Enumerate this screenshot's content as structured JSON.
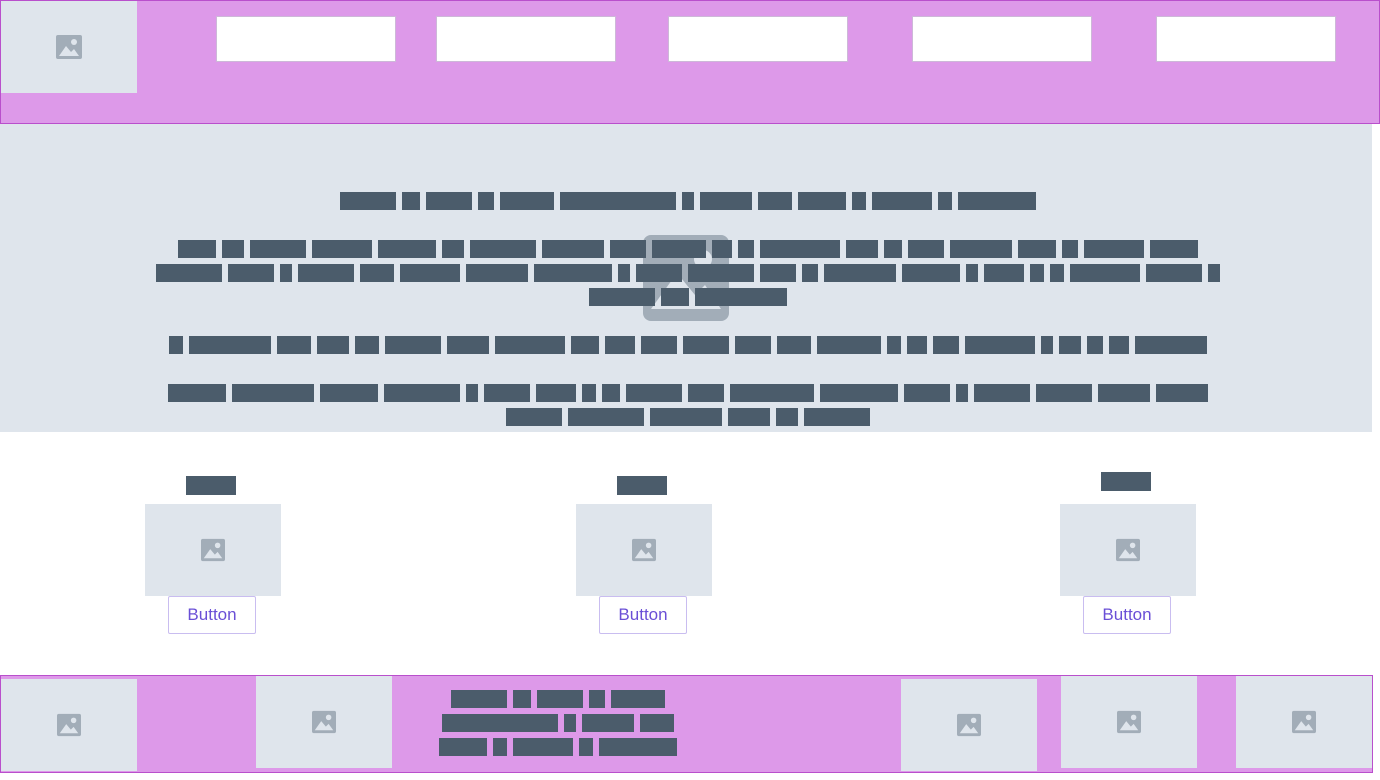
{
  "header": {
    "logo_icon": "image-icon",
    "nav_boxes": 5
  },
  "hero": {
    "background_icon": "image-icon"
  },
  "cards": [
    {
      "image_icon": "image-icon",
      "button_label": "Button"
    },
    {
      "image_icon": "image-icon",
      "button_label": "Button"
    },
    {
      "image_icon": "image-icon",
      "button_label": "Button"
    }
  ],
  "footer": {
    "images": [
      "image-icon",
      "image-icon",
      "image-icon",
      "image-icon",
      "image-icon"
    ]
  },
  "colors": {
    "header_bg": "#dd99e9",
    "header_border": "#b94fcc",
    "placeholder_bg": "#dfe5ec",
    "text_block": "#4b5c6b",
    "button_text": "#6a4fd6",
    "button_border": "#c9bdf0"
  }
}
